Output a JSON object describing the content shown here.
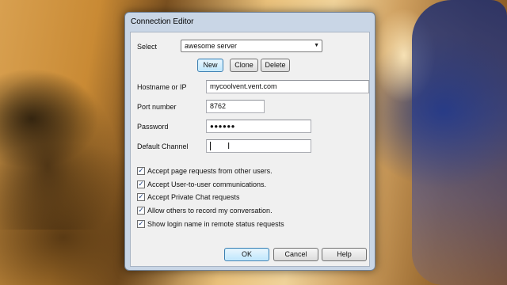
{
  "dialog": {
    "title": "Connection Editor"
  },
  "select": {
    "label": "Select",
    "value": "awesome server",
    "arrow": "▼"
  },
  "buttons": {
    "new": "New",
    "clone": "Clone",
    "delete": "Delete",
    "ok": "OK",
    "cancel": "Cancel",
    "help": "Help"
  },
  "fields": {
    "hostname": {
      "label": "Hostname or IP",
      "value": "mycoolvent.vent.com"
    },
    "port": {
      "label": "Port number",
      "value": "8762"
    },
    "password": {
      "label": "Password",
      "value": "●●●●●●"
    },
    "channel": {
      "label": "Default Channel",
      "value": "",
      "cursor": "I"
    }
  },
  "options": [
    {
      "label": "Accept page requests from other users.",
      "checked": true
    },
    {
      "label": "Accept User-to-user communications.",
      "checked": true
    },
    {
      "label": "Accept Private Chat requests",
      "checked": true
    },
    {
      "label": "Allow others to record my conversation.",
      "checked": true
    },
    {
      "label": "Show login name in remote status requests",
      "checked": true
    }
  ],
  "check_mark": "✓"
}
